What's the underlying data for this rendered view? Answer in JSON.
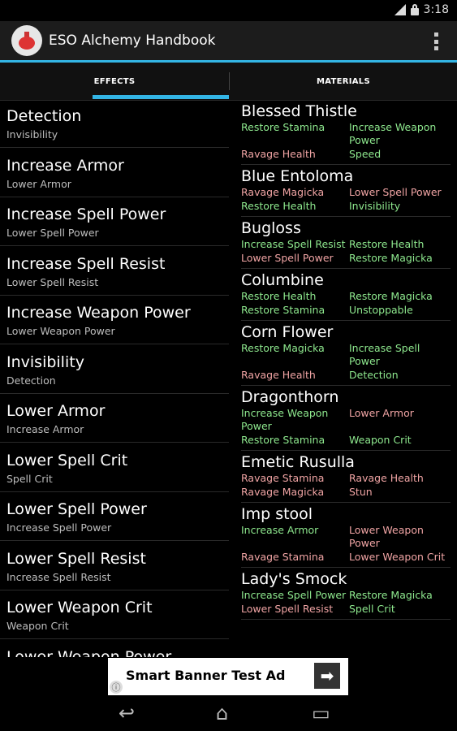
{
  "status": {
    "time": "3:18"
  },
  "app": {
    "title": "ESO Alchemy Handbook"
  },
  "tabs": [
    {
      "label": "EFFECTS"
    },
    {
      "label": "MATERIALS"
    }
  ],
  "effects": [
    {
      "title": "Detection",
      "subtitle": "Invisibility"
    },
    {
      "title": "Increase Armor",
      "subtitle": "Lower Armor"
    },
    {
      "title": "Increase Spell Power",
      "subtitle": "Lower Spell Power"
    },
    {
      "title": "Increase Spell Resist",
      "subtitle": "Lower Spell Resist"
    },
    {
      "title": "Increase Weapon Power",
      "subtitle": "Lower Weapon Power"
    },
    {
      "title": "Invisibility",
      "subtitle": "Detection"
    },
    {
      "title": "Lower Armor",
      "subtitle": "Increase Armor"
    },
    {
      "title": "Lower Spell Crit",
      "subtitle": "Spell Crit"
    },
    {
      "title": "Lower Spell Power",
      "subtitle": "Increase Spell Power"
    },
    {
      "title": "Lower Spell Resist",
      "subtitle": "Increase Spell Resist"
    },
    {
      "title": "Lower Weapon Crit",
      "subtitle": "Weapon Crit"
    },
    {
      "title": "Lower Weapon Power",
      "subtitle": ""
    }
  ],
  "materials": [
    {
      "name": "Blessed Thistle",
      "effects": [
        {
          "text": "Restore Stamina",
          "kind": "pos"
        },
        {
          "text": "Increase Weapon Power",
          "kind": "pos"
        },
        {
          "text": "Ravage Health",
          "kind": "neg"
        },
        {
          "text": "Speed",
          "kind": "pos"
        }
      ]
    },
    {
      "name": "Blue Entoloma",
      "effects": [
        {
          "text": "Ravage Magicka",
          "kind": "neg"
        },
        {
          "text": "Lower Spell Power",
          "kind": "neg"
        },
        {
          "text": "Restore Health",
          "kind": "pos"
        },
        {
          "text": "Invisibility",
          "kind": "pos"
        }
      ]
    },
    {
      "name": "Bugloss",
      "effects": [
        {
          "text": "Increase Spell Resist",
          "kind": "pos"
        },
        {
          "text": "Restore Health",
          "kind": "pos"
        },
        {
          "text": "Lower Spell Power",
          "kind": "neg"
        },
        {
          "text": "Restore Magicka",
          "kind": "pos"
        }
      ]
    },
    {
      "name": "Columbine",
      "effects": [
        {
          "text": "Restore Health",
          "kind": "pos"
        },
        {
          "text": "Restore Magicka",
          "kind": "pos"
        },
        {
          "text": "Restore Stamina",
          "kind": "pos"
        },
        {
          "text": "Unstoppable",
          "kind": "pos"
        }
      ]
    },
    {
      "name": "Corn Flower",
      "effects": [
        {
          "text": "Restore Magicka",
          "kind": "pos"
        },
        {
          "text": "Increase Spell Power",
          "kind": "pos"
        },
        {
          "text": "Ravage Health",
          "kind": "neg"
        },
        {
          "text": "Detection",
          "kind": "pos"
        }
      ]
    },
    {
      "name": "Dragonthorn",
      "effects": [
        {
          "text": "Increase Weapon Power",
          "kind": "pos"
        },
        {
          "text": "Lower Armor",
          "kind": "neg"
        },
        {
          "text": "Restore Stamina",
          "kind": "pos"
        },
        {
          "text": "Weapon Crit",
          "kind": "pos"
        }
      ]
    },
    {
      "name": "Emetic Rusulla",
      "effects": [
        {
          "text": "Ravage Stamina",
          "kind": "neg"
        },
        {
          "text": "Ravage Health",
          "kind": "neg"
        },
        {
          "text": "Ravage Magicka",
          "kind": "neg"
        },
        {
          "text": "Stun",
          "kind": "neg"
        }
      ]
    },
    {
      "name": "Imp stool",
      "effects": [
        {
          "text": "Increase Armor",
          "kind": "pos"
        },
        {
          "text": "Lower Weapon Power",
          "kind": "neg"
        },
        {
          "text": "Ravage Stamina",
          "kind": "neg"
        },
        {
          "text": "Lower Weapon Crit",
          "kind": "neg"
        }
      ]
    },
    {
      "name": "Lady's Smock",
      "effects": [
        {
          "text": "Increase Spell Power",
          "kind": "pos"
        },
        {
          "text": "Restore Magicka",
          "kind": "pos"
        },
        {
          "text": "Lower Spell Resist",
          "kind": "neg"
        },
        {
          "text": "Spell Crit",
          "kind": "pos"
        }
      ]
    }
  ],
  "ad": {
    "text": "Smart Banner Test Ad",
    "arrow": "➡",
    "info": "ⓘ"
  },
  "nav": {
    "back": "↩",
    "home": "⌂",
    "recent": "▭"
  },
  "colors": {
    "accent": "#33b5e5",
    "positive": "#8ee88e",
    "negative": "#f0a4a4"
  }
}
